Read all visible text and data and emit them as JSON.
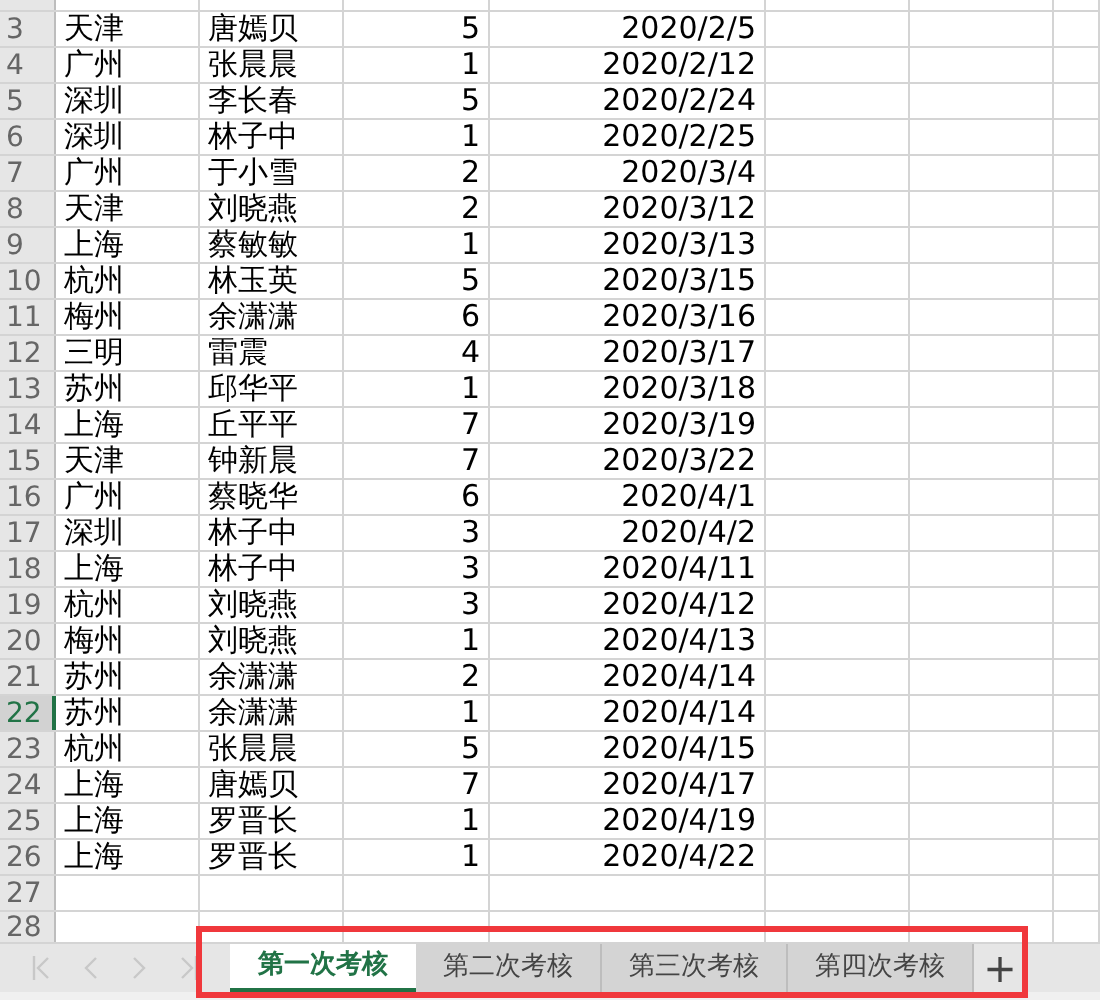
{
  "rows": [
    {
      "header": "3",
      "cells": [
        "天津",
        "唐嫣贝",
        "5",
        "2020/2/5"
      ],
      "selected": false
    },
    {
      "header": "4",
      "cells": [
        "广州",
        "张晨晨",
        "1",
        "2020/2/12"
      ],
      "selected": false
    },
    {
      "header": "5",
      "cells": [
        "深圳",
        "李长春",
        "5",
        "2020/2/24"
      ],
      "selected": false
    },
    {
      "header": "6",
      "cells": [
        "深圳",
        "林子中",
        "1",
        "2020/2/25"
      ],
      "selected": false
    },
    {
      "header": "7",
      "cells": [
        "广州",
        "于小雪",
        "2",
        "2020/3/4"
      ],
      "selected": false
    },
    {
      "header": "8",
      "cells": [
        "天津",
        "刘晓燕",
        "2",
        "2020/3/12"
      ],
      "selected": false
    },
    {
      "header": "9",
      "cells": [
        "上海",
        "蔡敏敏",
        "1",
        "2020/3/13"
      ],
      "selected": false
    },
    {
      "header": "10",
      "cells": [
        "杭州",
        "林玉英",
        "5",
        "2020/3/15"
      ],
      "selected": false
    },
    {
      "header": "11",
      "cells": [
        "梅州",
        "余潇潇",
        "6",
        "2020/3/16"
      ],
      "selected": false
    },
    {
      "header": "12",
      "cells": [
        "三明",
        "雷震",
        "4",
        "2020/3/17"
      ],
      "selected": false
    },
    {
      "header": "13",
      "cells": [
        "苏州",
        "邱华平",
        "1",
        "2020/3/18"
      ],
      "selected": false
    },
    {
      "header": "14",
      "cells": [
        "上海",
        "丘平平",
        "7",
        "2020/3/19"
      ],
      "selected": false
    },
    {
      "header": "15",
      "cells": [
        "天津",
        "钟新晨",
        "7",
        "2020/3/22"
      ],
      "selected": false
    },
    {
      "header": "16",
      "cells": [
        "广州",
        "蔡晓华",
        "6",
        "2020/4/1"
      ],
      "selected": false
    },
    {
      "header": "17",
      "cells": [
        "深圳",
        "林子中",
        "3",
        "2020/4/2"
      ],
      "selected": false
    },
    {
      "header": "18",
      "cells": [
        "上海",
        "林子中",
        "3",
        "2020/4/11"
      ],
      "selected": false
    },
    {
      "header": "19",
      "cells": [
        "杭州",
        "刘晓燕",
        "3",
        "2020/4/12"
      ],
      "selected": false
    },
    {
      "header": "20",
      "cells": [
        "梅州",
        "刘晓燕",
        "1",
        "2020/4/13"
      ],
      "selected": false
    },
    {
      "header": "21",
      "cells": [
        "苏州",
        "余潇潇",
        "2",
        "2020/4/14"
      ],
      "selected": false
    },
    {
      "header": "22",
      "cells": [
        "苏州",
        "余潇潇",
        "1",
        "2020/4/14"
      ],
      "selected": true
    },
    {
      "header": "23",
      "cells": [
        "杭州",
        "张晨晨",
        "5",
        "2020/4/15"
      ],
      "selected": false
    },
    {
      "header": "24",
      "cells": [
        "上海",
        "唐嫣贝",
        "7",
        "2020/4/17"
      ],
      "selected": false
    },
    {
      "header": "25",
      "cells": [
        "上海",
        "罗晋长",
        "1",
        "2020/4/19"
      ],
      "selected": false
    },
    {
      "header": "26",
      "cells": [
        "上海",
        "罗晋长",
        "1",
        "2020/4/22"
      ],
      "selected": false
    },
    {
      "header": "27",
      "cells": [],
      "selected": false
    },
    {
      "header": "28",
      "cells": [],
      "selected": false
    }
  ],
  "sheet_tabs": [
    {
      "label": "第一次考核",
      "selected": true
    },
    {
      "label": "第二次考核",
      "selected": false
    },
    {
      "label": "第三次考核",
      "selected": false
    },
    {
      "label": "第四次考核",
      "selected": false
    }
  ],
  "add_sheet": "+"
}
